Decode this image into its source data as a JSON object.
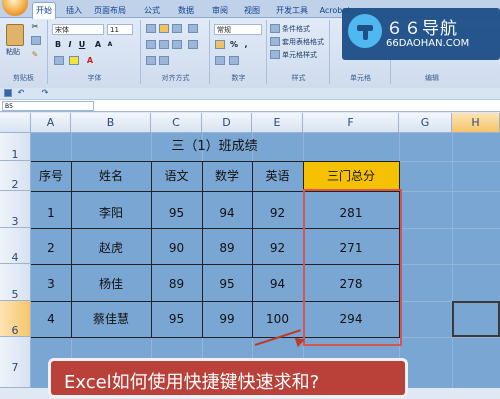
{
  "ribbon": {
    "tabs": [
      "开始",
      "插入",
      "页面布局",
      "公式",
      "数据",
      "审阅",
      "视图",
      "开发工具",
      "Acrobat"
    ],
    "font_name": "宋体",
    "font_size": "11",
    "number_format": "常规",
    "clipboard": {
      "paste": "粘贴",
      "label": "剪贴板"
    },
    "groups": {
      "font": "字体",
      "align": "对齐方式",
      "number": "数字",
      "style": "样式",
      "cells": "单元格",
      "edit": "编辑"
    },
    "style_items": [
      "条件格式",
      "套用表格格式",
      "单元格样式"
    ],
    "number_symbols": [
      "%",
      ","
    ]
  },
  "logo": {
    "title": "６６导航",
    "sub": "66DAOHAN.COM"
  },
  "formula_bar": {
    "name_box": "B5"
  },
  "columns": [
    "A",
    "B",
    "C",
    "D",
    "E",
    "F",
    "G",
    "H"
  ],
  "rows": [
    "1",
    "2",
    "3",
    "4",
    "5",
    "6",
    "7"
  ],
  "table": {
    "title": "三（1）班成绩",
    "headers": [
      "序号",
      "姓名",
      "语文",
      "数学",
      "英语",
      "三门总分"
    ],
    "rows": [
      [
        "1",
        "李阳",
        "95",
        "94",
        "92",
        "281"
      ],
      [
        "2",
        "赵虎",
        "90",
        "89",
        "92",
        "271"
      ],
      [
        "3",
        "杨佳",
        "89",
        "95",
        "94",
        "278"
      ],
      [
        "4",
        "蔡佳慧",
        "95",
        "99",
        "100",
        "294"
      ]
    ]
  },
  "banner": {
    "text": "Excel如何使用快捷键快速求和?"
  },
  "colors": {
    "highlight": "#f6c100",
    "sheet_bg": "#7aa6d3",
    "red": "#d9534f"
  }
}
